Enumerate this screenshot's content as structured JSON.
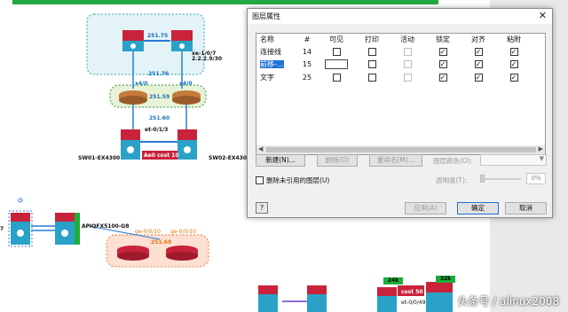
{
  "diagram": {
    "labels": {
      "ip_top": "251.75",
      "ip_76": "251.76",
      "ip_59": "251.59",
      "ip_60": "251.60",
      "ip_68": "251.68",
      "iface_right_top": "xe-1/0/7",
      "ip_right_top": "2.2.2.9/30",
      "x40_left": "x4/0",
      "x40_right": "x4/0",
      "et013": "et-0/1/3",
      "ae0": "Ae0 cost 10",
      "sw01": "SW01-EX4300",
      "sw02": "SW02-EX4300",
      "apiq": "APIQFX5100-G8",
      "ge010_left": "ge-0/0/10",
      "ge010_right": "ge-0/0/10",
      "left_num": "7",
      "tag24k": "24k",
      "tag32k": "32k",
      "cost50": "cost 50",
      "et0049": "et-0/0/49"
    },
    "watermark": "头条号 / alinux2008"
  },
  "dialog": {
    "title": "图层属性",
    "close_glyph": "✕",
    "columns": [
      "名称",
      "#",
      "可见",
      "打印",
      "活动",
      "锁定",
      "对齐",
      "粘附"
    ],
    "rows": [
      {
        "name": "连接线",
        "num": "14",
        "visible": false,
        "print": false,
        "active": false,
        "lock": true,
        "snap": true,
        "glue": true,
        "selected": false
      },
      {
        "name": "前移-…",
        "num": "15",
        "visible": false,
        "print": false,
        "active": false,
        "lock": true,
        "snap": true,
        "glue": true,
        "selected": true
      },
      {
        "name": "文字",
        "num": "25",
        "visible": false,
        "print": false,
        "active": false,
        "lock": true,
        "snap": true,
        "glue": true,
        "selected": false
      }
    ],
    "buttons": {
      "new": "新建(N)...",
      "delete": "删除(D)",
      "rename": "重命名(M)...",
      "apply": "应用(A)",
      "ok": "确定",
      "cancel": "取消"
    },
    "layer_color_label": "图层颜色(O):",
    "remove_unref_label": "删除未引用的图层(U)",
    "transparency_label": "透明度(T):",
    "transparency_value": "0%",
    "help_glyph": "?"
  }
}
